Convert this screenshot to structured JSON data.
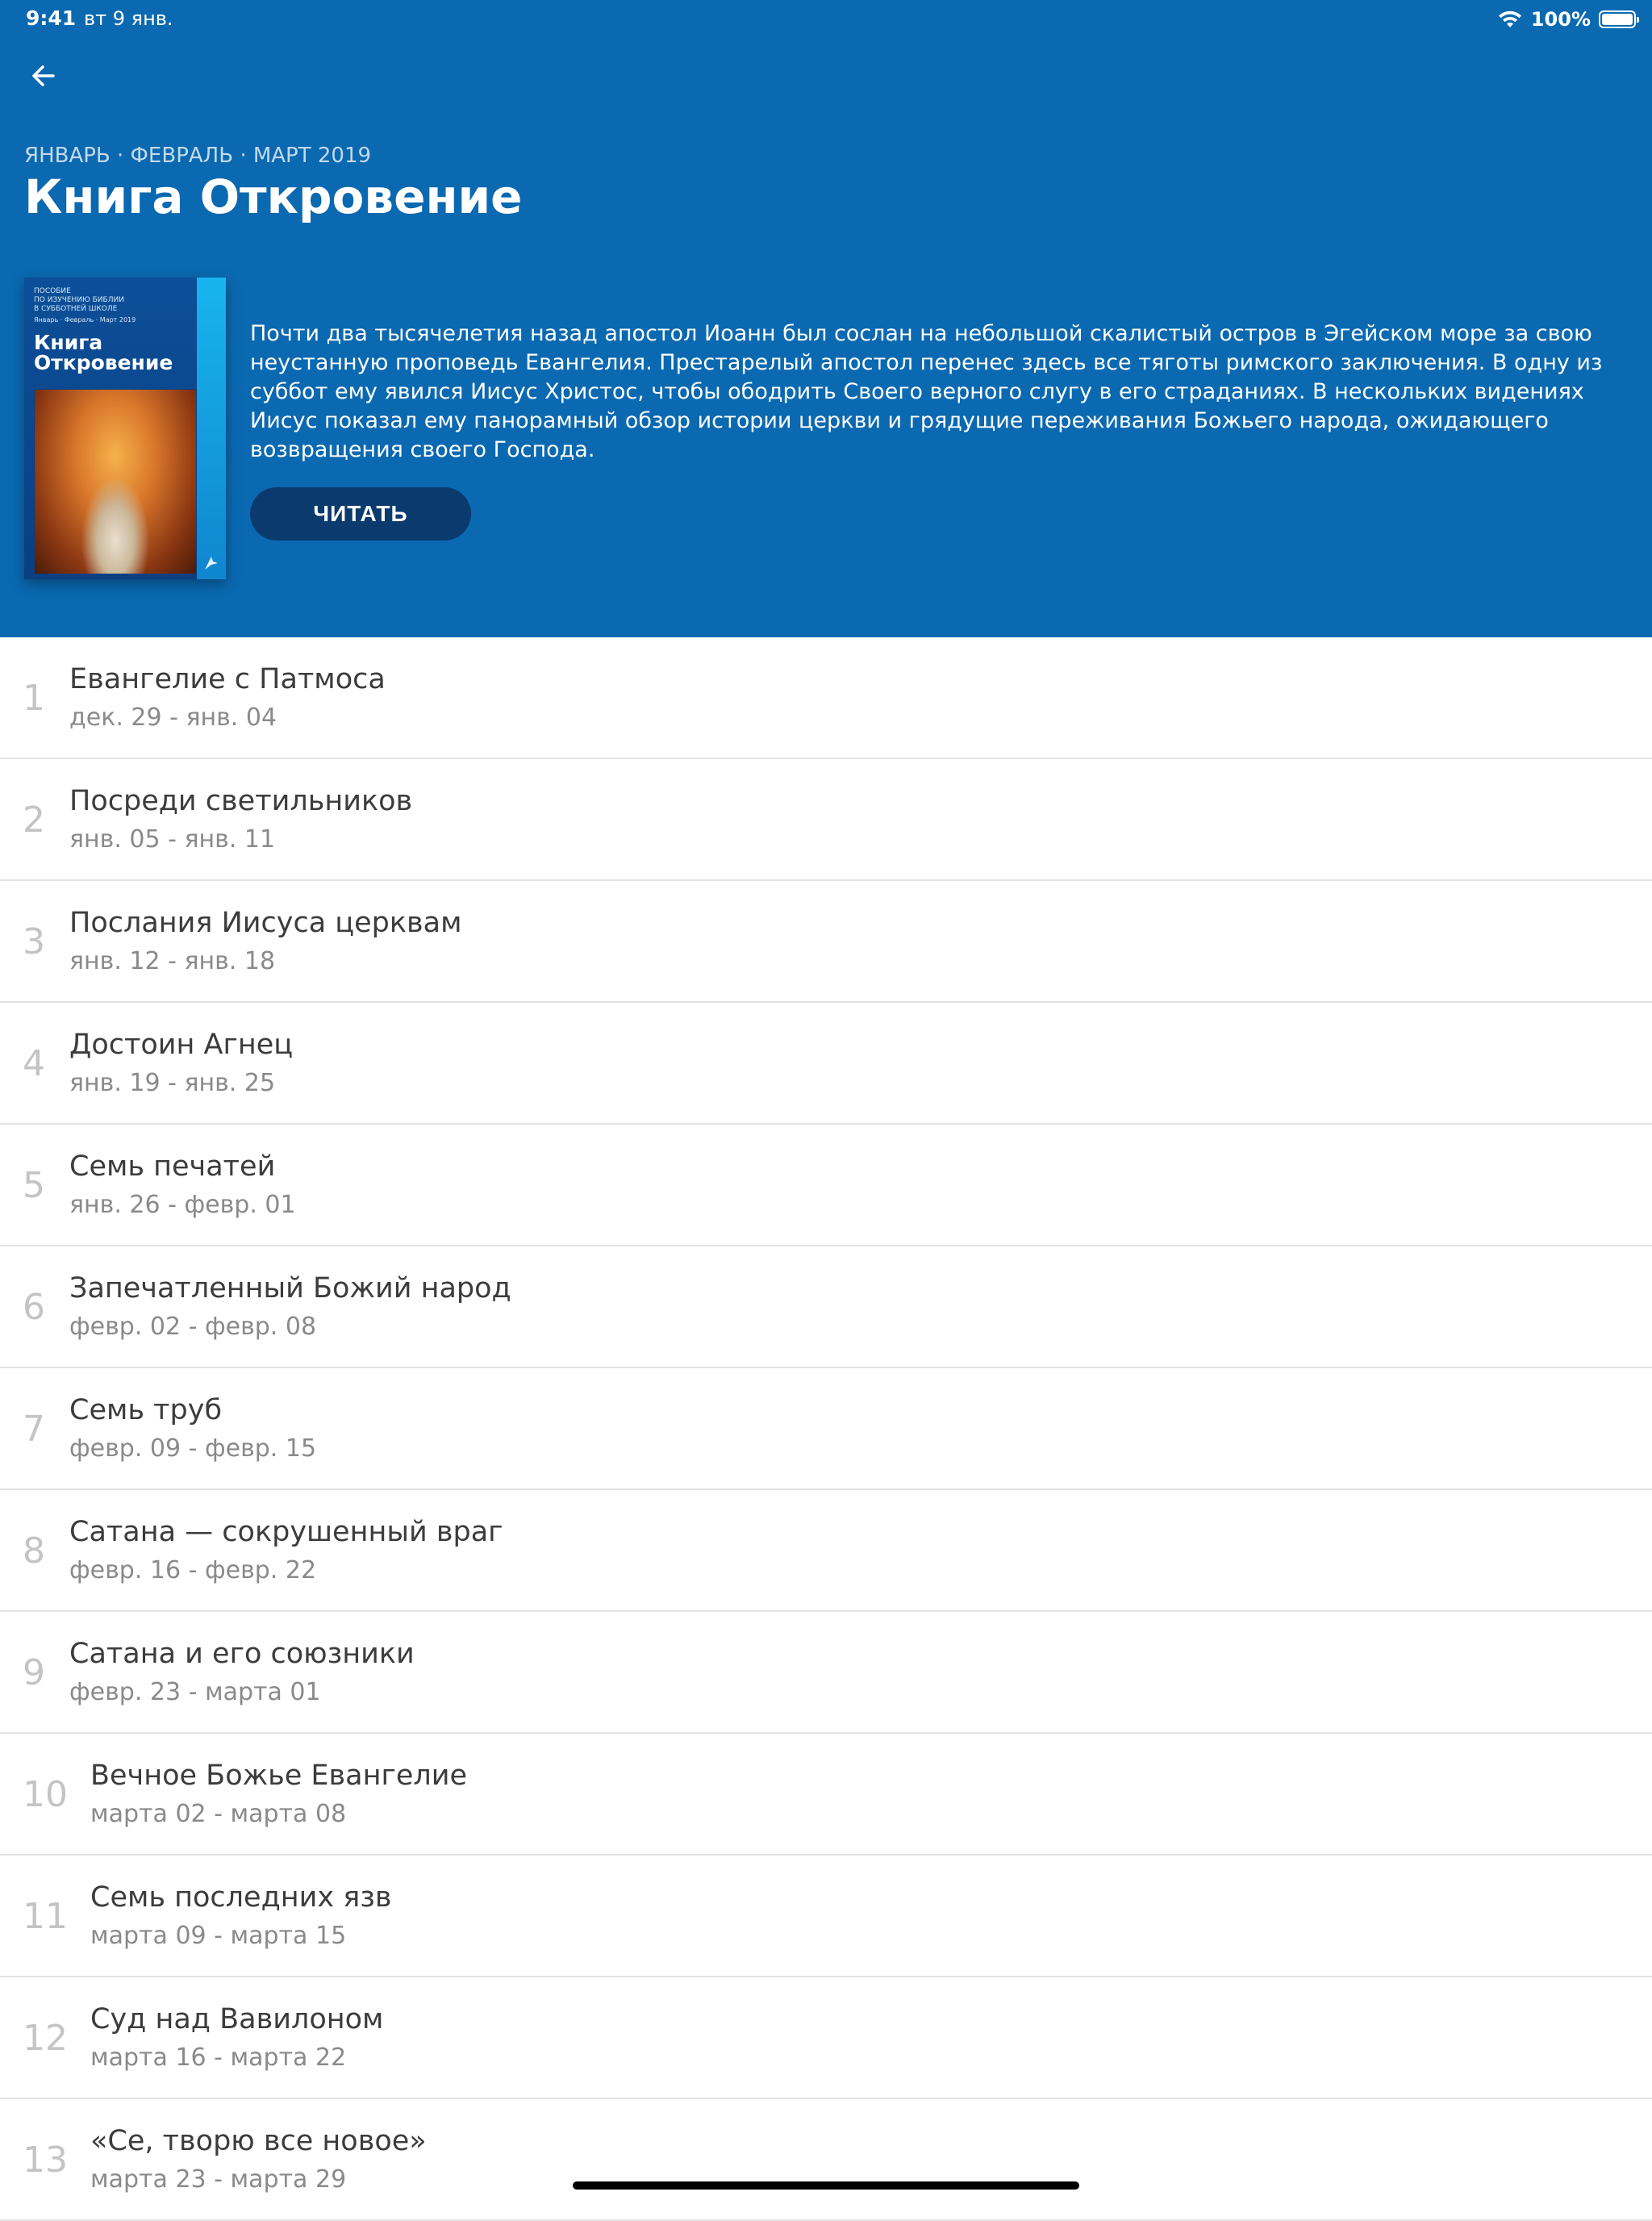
{
  "status_bar": {
    "time": "9:41",
    "date": "вт 9 янв.",
    "battery": "100%"
  },
  "header": {
    "quarter": "ЯНВАРЬ · ФЕВРАЛЬ · МАРТ 2019",
    "title": "Книга Откровение",
    "description": "Почти два тысячелетия назад апостол Иоанн был сослан на небольшой скалистый остров в Эгейском море за свою неустанную проповедь Евангелия. Престарелый апостол перенес здесь все тяготы римского заключения. В одну из суббот ему явился Иисус Христос, чтобы ободрить Своего верного слугу в его страданиях. В нескольких видениях Иисус показал ему панорамный обзор истории церкви и грядущие переживания Божьего народа, ожидающего возвращения своего Господа.",
    "read_button": "ЧИТАТЬ",
    "cover": {
      "top_line_1": "ПОСОБИЕ",
      "top_line_2": "ПО ИЗУЧЕНИЮ БИБЛИИ",
      "top_line_3": "В СУББОТНЕЙ ШКОЛЕ",
      "quarter": "Январь · Февраль · Март   2019",
      "title_line_1": "Книга",
      "title_line_2": "Откровение"
    }
  },
  "icons": {
    "back": "arrow-left-icon",
    "wifi": "wifi-icon",
    "battery": "battery-icon"
  },
  "colors": {
    "header_bg": "#0a69b1",
    "button_bg": "#0a3a6e",
    "divider": "#e2e2e2"
  },
  "lessons": [
    {
      "number": "1",
      "title": "Евангелие с Патмоса",
      "dates": "дек. 29 - янв. 04"
    },
    {
      "number": "2",
      "title": "Посреди светильников",
      "dates": "янв. 05 - янв. 11"
    },
    {
      "number": "3",
      "title": "Послания Иисуса церквам",
      "dates": "янв. 12 - янв. 18"
    },
    {
      "number": "4",
      "title": "Достоин Агнец",
      "dates": "янв. 19 - янв. 25"
    },
    {
      "number": "5",
      "title": "Семь печатей",
      "dates": "янв. 26 - февр. 01"
    },
    {
      "number": "6",
      "title": "Запечатленный Божий народ",
      "dates": "февр. 02 - февр. 08"
    },
    {
      "number": "7",
      "title": "Семь труб",
      "dates": "февр. 09 - февр. 15"
    },
    {
      "number": "8",
      "title": "Сатана — сокрушенный враг",
      "dates": "февр. 16 - февр. 22"
    },
    {
      "number": "9",
      "title": "Сатана и его союзники",
      "dates": "февр. 23 - марта 01"
    },
    {
      "number": "10",
      "title": "Вечное Божье Евангелие",
      "dates": "марта 02 - марта 08"
    },
    {
      "number": "11",
      "title": "Семь последних язв",
      "dates": "марта 09 - марта 15"
    },
    {
      "number": "12",
      "title": "Суд над Вавилоном",
      "dates": "марта 16 - марта 22"
    },
    {
      "number": "13",
      "title": "«Се, творю все новое»",
      "dates": "марта 23 - марта 29"
    }
  ]
}
